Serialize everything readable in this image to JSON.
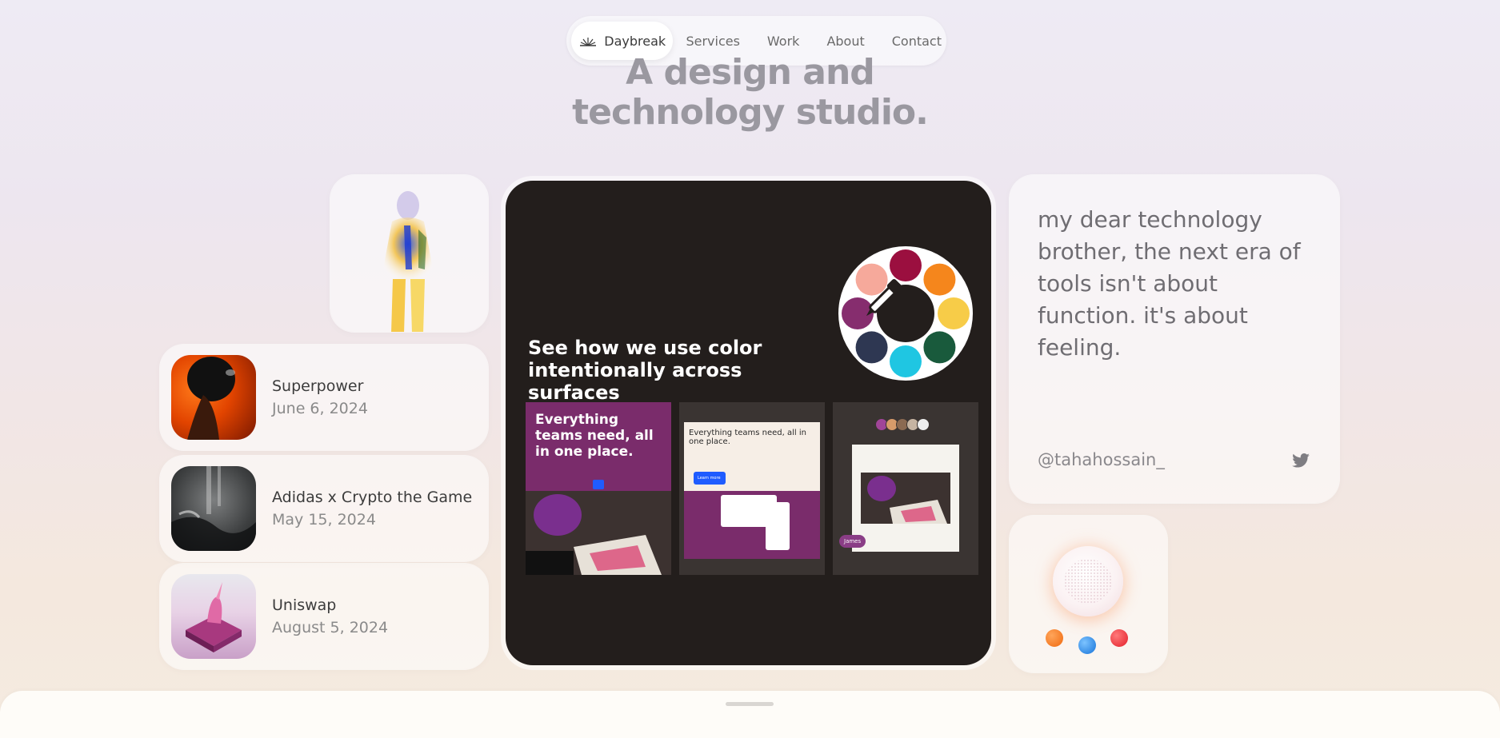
{
  "nav": {
    "brand": "Daybreak",
    "links": [
      "Services",
      "Work",
      "About",
      "Contact"
    ]
  },
  "hero": {
    "line1": "A design and",
    "line2": "technology studio."
  },
  "projects": [
    {
      "title": "Superpower",
      "date": "June 6, 2024"
    },
    {
      "title": "Adidas x Crypto the Game",
      "date": "May 15, 2024"
    },
    {
      "title": "Uniswap",
      "date": "August 5, 2024"
    }
  ],
  "feature": {
    "title": "See how we use color intentionally across surfaces",
    "shot1_text": "Everything teams need, all in one place.",
    "shot2_text": "Everything teams need, all in one place.",
    "shot2_button": "Learn more",
    "shot3_tag": "James",
    "wheel_colors": [
      "#9b0f3f",
      "#f5861c",
      "#f7cc48",
      "#195a3c",
      "#1fc6e2",
      "#2e3752",
      "#862d6e",
      "#f6a99b"
    ]
  },
  "quote": {
    "text": "my dear technology brother, the next era of tools isn't about function. it's about feeling.",
    "handle": "@tahahossain_",
    "icon": "twitter-icon"
  },
  "colors": {
    "center_card_bg": "#231e1c",
    "dot_orange": "#f06a10",
    "dot_blue": "#1673d9",
    "dot_red": "#e31f2a"
  }
}
